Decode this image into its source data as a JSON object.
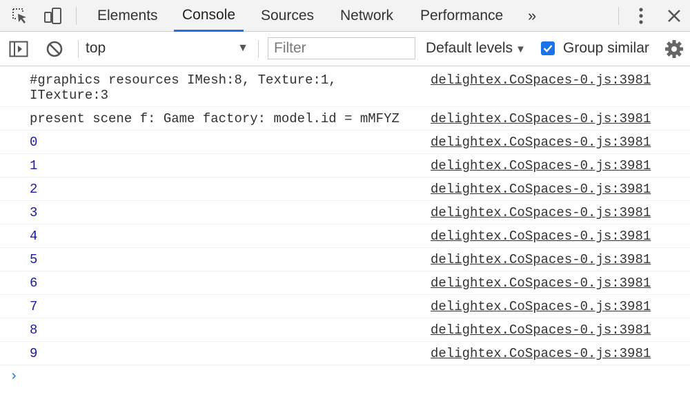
{
  "devtools": {
    "tabs": [
      {
        "label": "Elements"
      },
      {
        "label": "Console"
      },
      {
        "label": "Sources"
      },
      {
        "label": "Network"
      },
      {
        "label": "Performance"
      }
    ],
    "more_tabs_glyph": "»",
    "close_glyph": "✕"
  },
  "toolbar": {
    "context": "top",
    "filter_placeholder": "Filter",
    "levels": "Default levels",
    "group_similar": "Group similar",
    "group_similar_checked": true
  },
  "console": {
    "messages": [
      {
        "text": "#graphics resources IMesh:8, Texture:1,\nITexture:3",
        "source": "delightex.CoSpaces-0.js:3981"
      },
      {
        "text": "present scene f: Game factory: model.id = mMFYZ",
        "source": "delightex.CoSpaces-0.js:3981"
      },
      {
        "text": "0",
        "source": "delightex.CoSpaces-0.js:3981"
      },
      {
        "text": "1",
        "source": "delightex.CoSpaces-0.js:3981"
      },
      {
        "text": "2",
        "source": "delightex.CoSpaces-0.js:3981"
      },
      {
        "text": "3",
        "source": "delightex.CoSpaces-0.js:3981"
      },
      {
        "text": "4",
        "source": "delightex.CoSpaces-0.js:3981"
      },
      {
        "text": "5",
        "source": "delightex.CoSpaces-0.js:3981"
      },
      {
        "text": "6",
        "source": "delightex.CoSpaces-0.js:3981"
      },
      {
        "text": "7",
        "source": "delightex.CoSpaces-0.js:3981"
      },
      {
        "text": "8",
        "source": "delightex.CoSpaces-0.js:3981"
      },
      {
        "text": "9",
        "source": "delightex.CoSpaces-0.js:3981"
      }
    ],
    "prompt_glyph": "›"
  },
  "colors": {
    "accent": "#1a73e8",
    "number_text": "#1a1aa6"
  }
}
